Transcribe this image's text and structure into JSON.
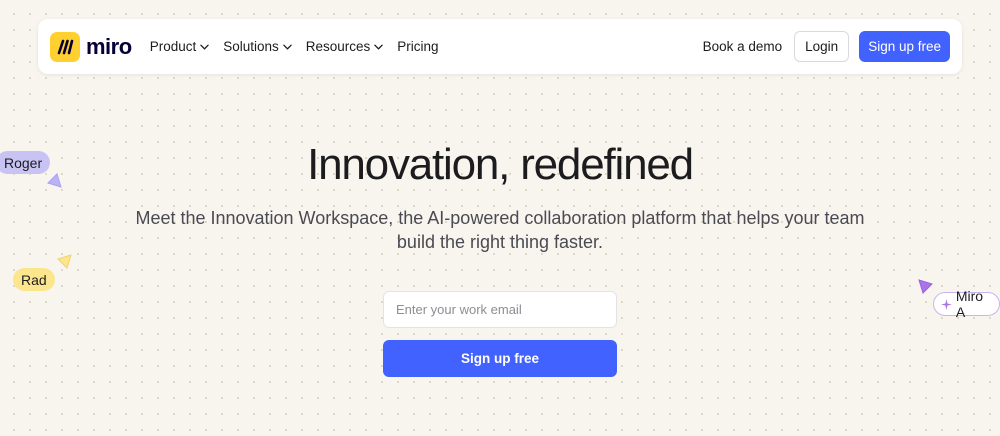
{
  "nav": {
    "brand": "miro",
    "links": [
      {
        "label": "Product",
        "has_dropdown": true
      },
      {
        "label": "Solutions",
        "has_dropdown": true
      },
      {
        "label": "Resources",
        "has_dropdown": true
      },
      {
        "label": "Pricing",
        "has_dropdown": false
      }
    ],
    "book_demo": "Book a demo",
    "login": "Login",
    "signup": "Sign up free"
  },
  "hero": {
    "title": "Innovation, redefined",
    "subtitle": "Meet the Innovation Workspace, the AI-powered collaboration platform that helps your team build the right thing faster.",
    "email_placeholder": "Enter your work email",
    "email_value": "",
    "signup": "Sign up free"
  },
  "cursors": [
    {
      "name": "Roger",
      "color": "#c9c3f4"
    },
    {
      "name": "Rad",
      "color": "#fce68d"
    },
    {
      "name": "Miro A",
      "color": "#a974e8"
    }
  ],
  "colors": {
    "accent": "#4262ff",
    "brand_yellow": "#ffd02f",
    "background": "#f8f5ef"
  },
  "icons": {
    "logo": "miro-logo-icon",
    "dropdown": "chevron-down-icon",
    "cursor": "cursor-arrow-icon",
    "ai_sparkle": "sparkle-icon"
  }
}
